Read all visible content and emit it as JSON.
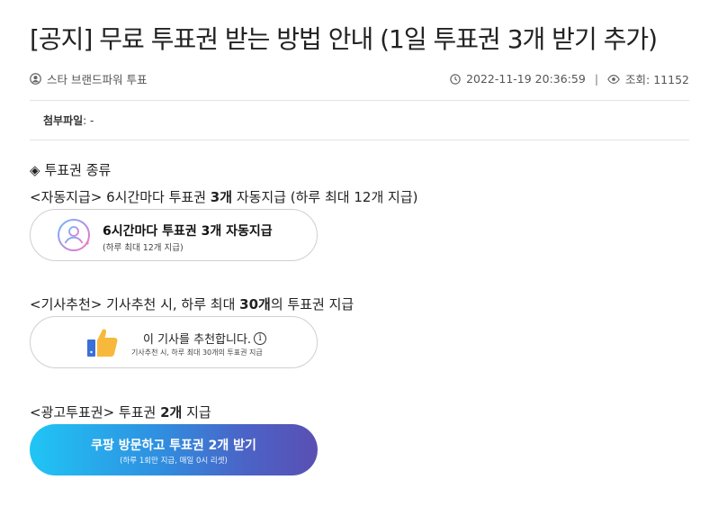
{
  "post": {
    "title": "[공지] 무료 투표권 받는 방법 안내 (1일 투표권 3개 받기 추가)",
    "author": "스타 브랜드파워 투표",
    "datetime": "2022-11-19 20:36:59",
    "separator": "|",
    "views_label": "조회: 11152",
    "attachment_label": "첨부파일",
    "attachment_value": ": -"
  },
  "content": {
    "section_marker": "◈",
    "section_title": "투표권 종류",
    "auto": {
      "prefix": "<자동지급> 6시간마다 투표권 ",
      "bold": "3개",
      "suffix": " 자동지급 (하루 최대 12개 지급)",
      "button_main": "6시간마다 투표권 3개 자동지급",
      "button_sub": "(하루 최대 12개 지급)"
    },
    "article": {
      "prefix": "<기사추천> 기사추천 시, 하루 최대 ",
      "bold": "30개",
      "suffix": "의 투표권 지급",
      "button_main": "이 기사를 추천합니다.",
      "info_glyph": "i",
      "button_sub": "기사추천 시, 하루 최대 30개의 투표권 지급"
    },
    "ad": {
      "prefix": "<광고투표권> 투표권 ",
      "bold": "2개",
      "suffix": " 지급",
      "button_main": "쿠팡 방문하고 투표권 2개 받기",
      "button_sub": "(하루 1회만 지급, 매일 0시 리셋)"
    }
  },
  "icons": {
    "author": "user-circle-icon",
    "time": "clock-icon",
    "views": "eye-icon",
    "avatar": "user-avatar-icon",
    "thumb": "thumbs-up-icon",
    "info": "info-icon"
  },
  "colors": {
    "gradient_start": "#20c5f5",
    "gradient_end": "#5a4fb3",
    "thumb_yellow": "#f6b93b",
    "thumb_blue": "#3a6fd8"
  }
}
